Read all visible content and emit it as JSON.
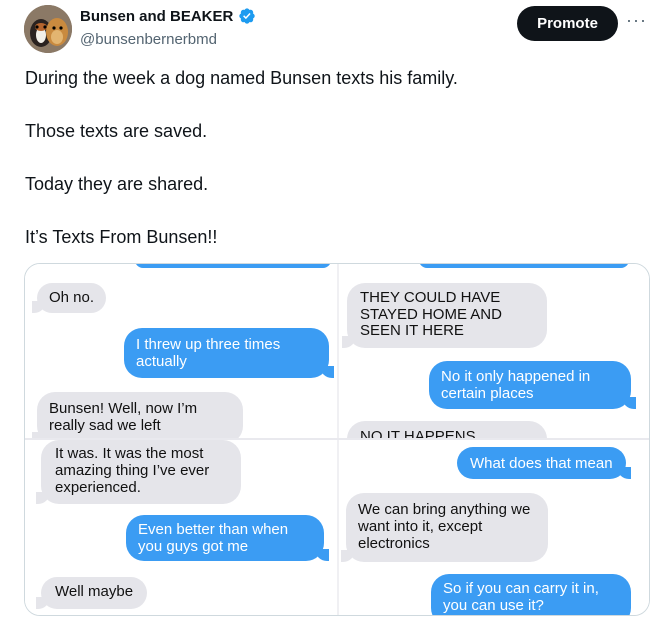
{
  "author": {
    "display_name": "Bunsen and BEAKER",
    "handle": "@bunsenbernerbmd",
    "verified_icon": "verified-badge-icon",
    "verified_color": "#1d9bf0"
  },
  "actions": {
    "promote_label": "Promote",
    "more_label": "···"
  },
  "tweet": {
    "lines": [
      "During the week a dog named Bunsen texts his family.",
      "Those texts are saved.",
      "Today they are shared.",
      "It’s Texts From Bunsen!!"
    ]
  },
  "media": {
    "bubble_gray": "#e5e5ea",
    "bubble_blue": "#3b9cf3",
    "left_top": {
      "gray1": "Oh no.",
      "blue1": "I threw up three times actually",
      "gray2": "Bunsen! Well, now I’m really sad we left"
    },
    "right_top": {
      "gray1": "THEY COULD HAVE STAYED HOME AND SEEN IT HERE",
      "blue1": "No it only happened in certain places",
      "gray2": "NO IT HAPPENS"
    },
    "left_bottom": {
      "gray1": "It was. It was the most amazing thing I’ve ever experienced.",
      "blue1": "Even better than when you guys got me",
      "gray2": "Well maybe"
    },
    "right_bottom": {
      "blue1": "What does that mean",
      "gray1": "We can bring anything we want into it, except electronics",
      "blue2": "So if you can carry it in, you can use it?"
    }
  }
}
